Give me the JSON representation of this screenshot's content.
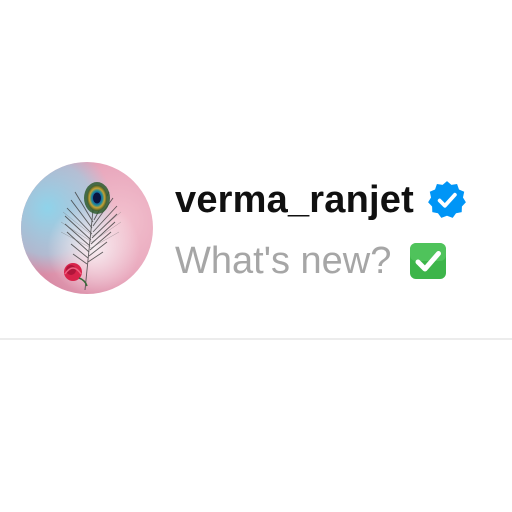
{
  "composer": {
    "username": "verma_ranjet",
    "prompt_placeholder": "What's new?",
    "verified_badge_icon": "verified-badge-icon",
    "prompt_emoji_icon": "white-check-mark-icon",
    "avatar_image": "peacock-feather-with-rose",
    "colors": {
      "username": "#101010",
      "placeholder": "#a6a6a6",
      "verified_badge": "#0095f6",
      "check_emoji": "#3db54a",
      "divider": "#ececec"
    }
  }
}
